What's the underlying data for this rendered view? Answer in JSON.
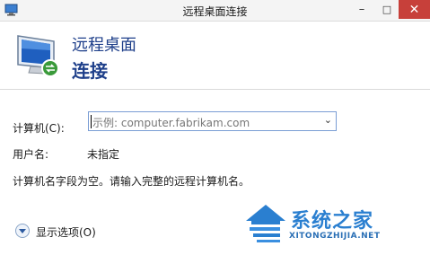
{
  "window": {
    "title": "远程桌面连接",
    "controls": {
      "minimize": "–",
      "maximize": "□",
      "close": "✕"
    }
  },
  "header": {
    "line1": "远程桌面",
    "line2": "连接"
  },
  "form": {
    "computer_label": "计算机(C):",
    "computer_placeholder": "示例: computer.fabrikam.com",
    "user_label": "用户名:",
    "user_value": "未指定",
    "warning": "计算机名字段为空。请输入完整的远程计算机名。",
    "options_label": "显示选项(O)"
  },
  "watermark": {
    "cn": "系统之家",
    "en": "XITONGZHIJIA.NET"
  },
  "colors": {
    "header_text": "#1e3f8a",
    "close_button": "#c7403a",
    "watermark": "#2a7fd0"
  }
}
